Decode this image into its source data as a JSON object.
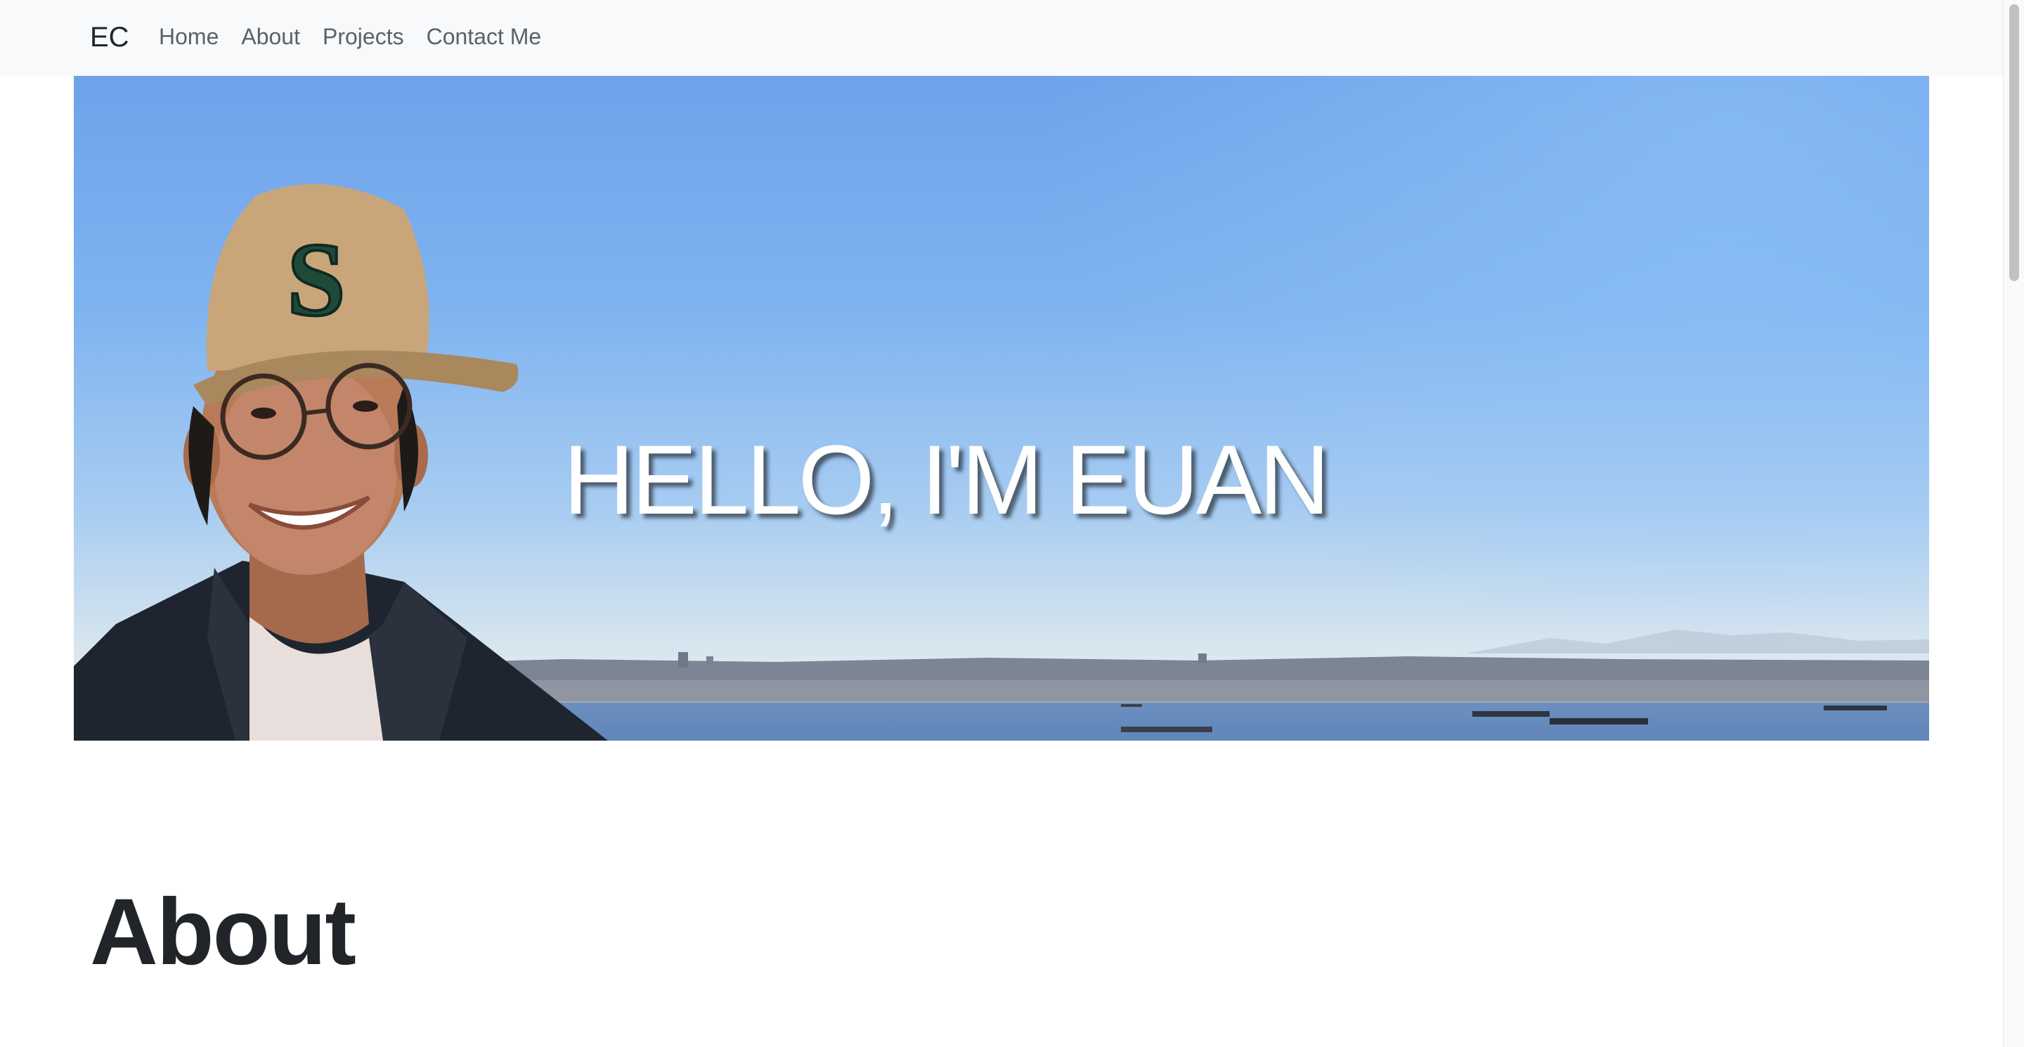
{
  "navbar": {
    "brand": "EC",
    "links": [
      {
        "label": "Home"
      },
      {
        "label": "About"
      },
      {
        "label": "Projects"
      },
      {
        "label": "Contact Me"
      }
    ]
  },
  "hero": {
    "title": "HELLO, I'M EUAN",
    "photo_subject": "portrait-photo"
  },
  "about": {
    "heading": "About"
  },
  "colors": {
    "navbar_bg": "#f8f9fa",
    "text_dark": "#212529",
    "nav_link": "#5c6166",
    "sky": "#7fb3f0",
    "hero_text": "#ffffff"
  }
}
